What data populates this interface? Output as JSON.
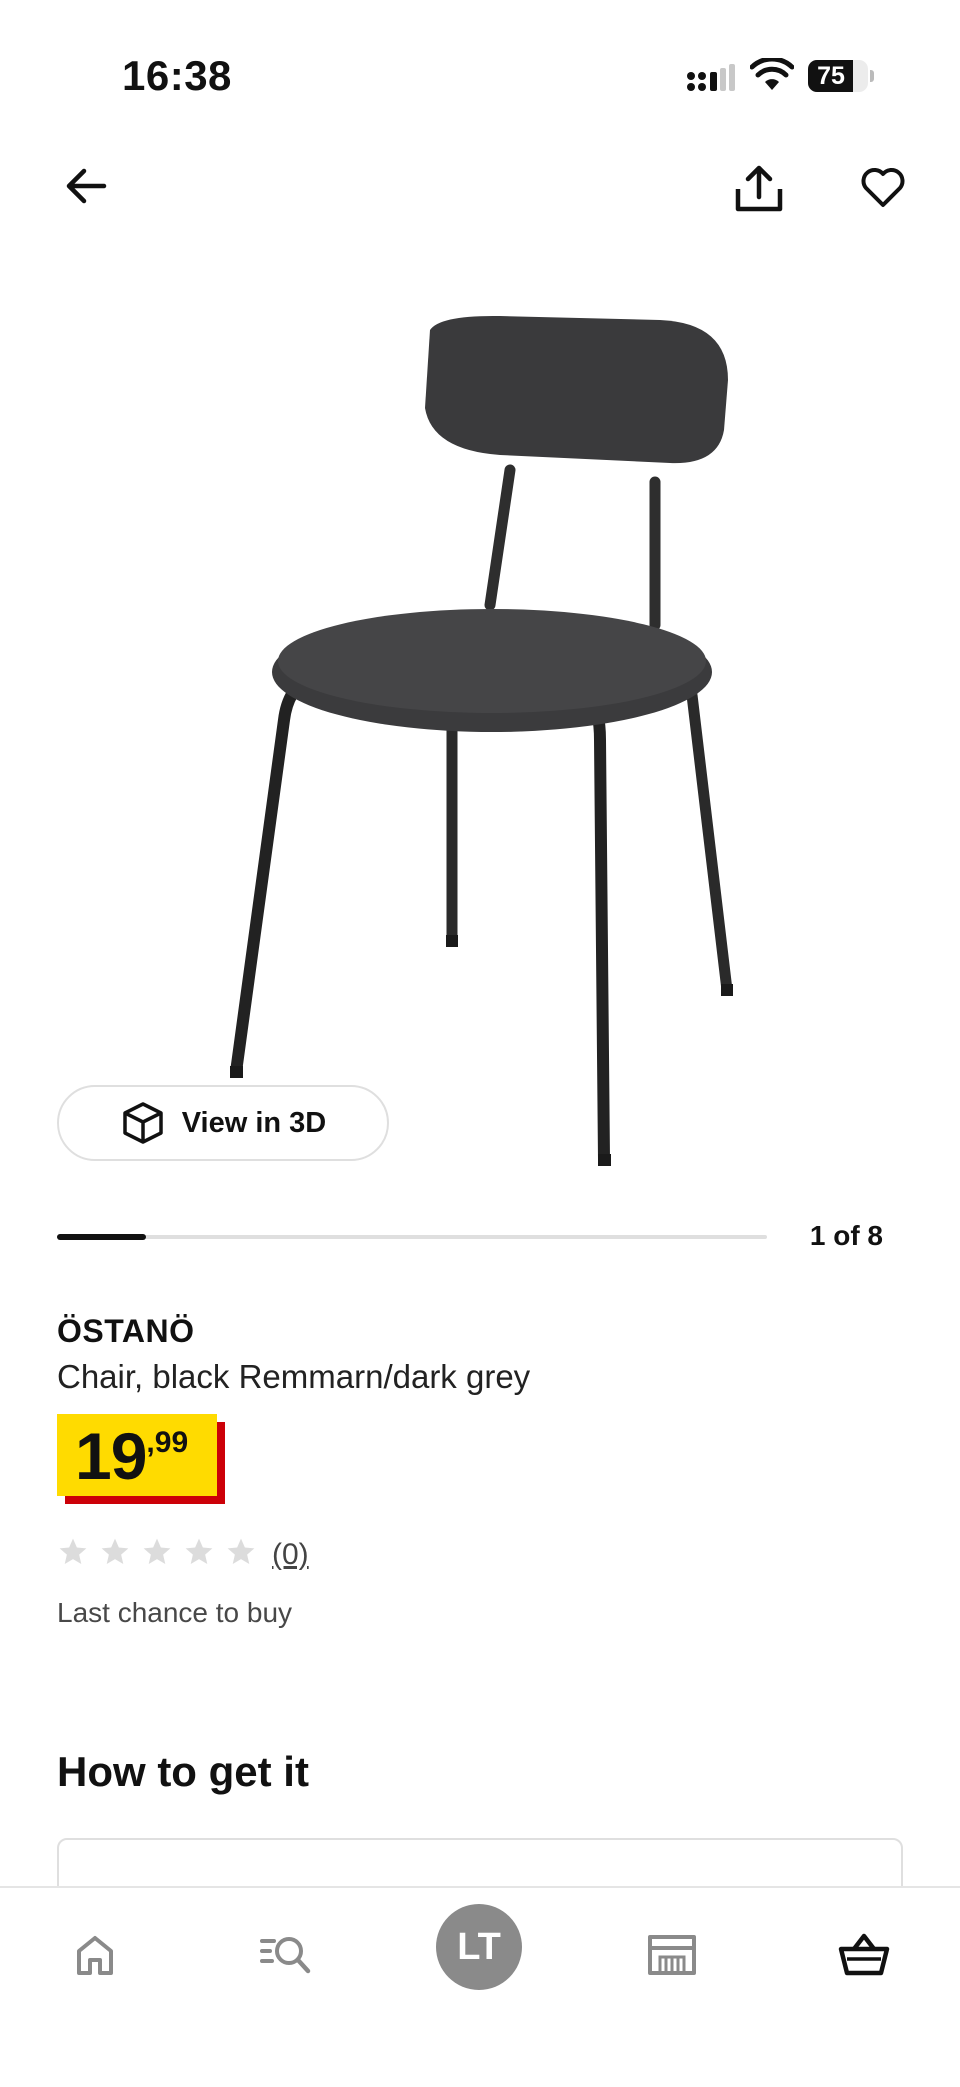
{
  "status_bar": {
    "time": "16:38",
    "battery_level": "75",
    "battery_fraction": 0.75
  },
  "top_nav": {
    "back_icon": "arrow-left-icon",
    "share_icon": "share-icon",
    "favorite_icon": "heart-icon"
  },
  "gallery": {
    "image_subject": "chair",
    "view3d_label": "View in 3D",
    "view3d_icon": "cube-icon",
    "counter": "1 of 8",
    "current_index": 1,
    "total": 8
  },
  "product": {
    "name": "ÖSTANÖ",
    "description": "Chair, black Remmarn/dark grey",
    "price_integer": "19",
    "price_decimal": ",99",
    "price_tag_color": "#ffdb00",
    "price_shadow_color": "#cc0008",
    "rating": 0,
    "rating_max": 5,
    "review_count": "(0)",
    "availability": "Last chance to buy"
  },
  "delivery": {
    "title": "How to get it"
  },
  "tab_bar": {
    "items": [
      {
        "icon": "home-icon"
      },
      {
        "icon": "search-list-icon"
      },
      {
        "avatar_initials": "LT"
      },
      {
        "icon": "store-icon"
      },
      {
        "icon": "basket-icon"
      }
    ]
  }
}
